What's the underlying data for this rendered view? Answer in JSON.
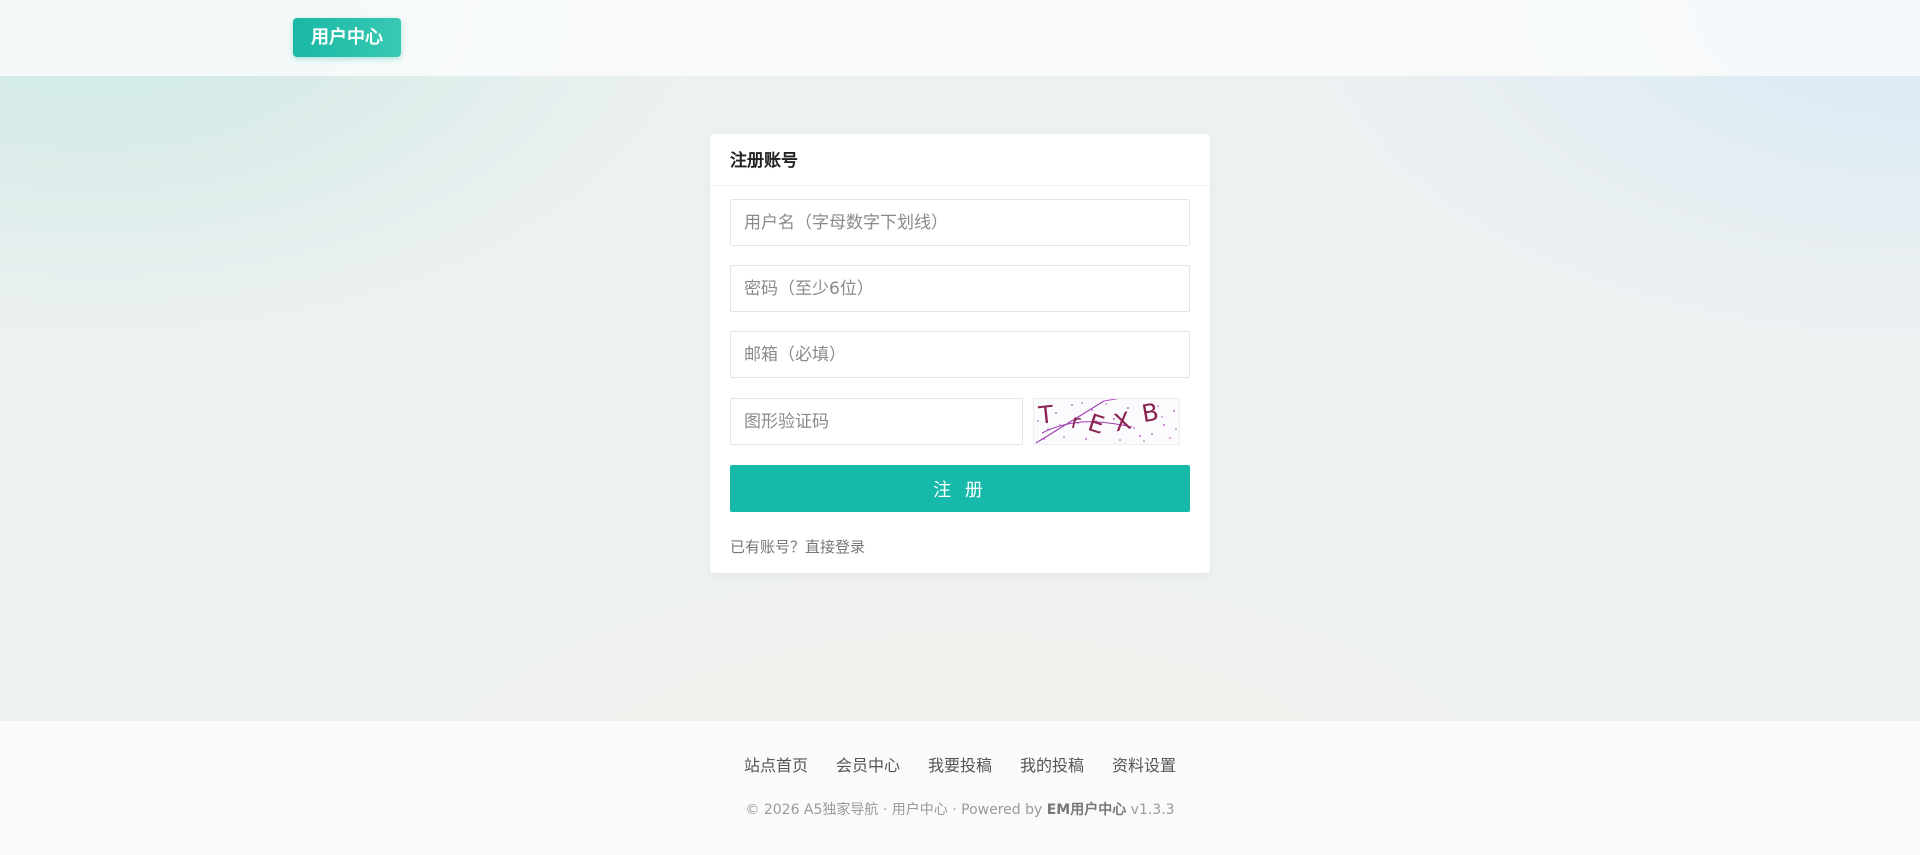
{
  "header": {
    "logo_label": "用户中心"
  },
  "register": {
    "title": "注册账号",
    "username_placeholder": "用户名（字母数字下划线）",
    "password_placeholder": "密码（至少6位）",
    "email_placeholder": "邮箱（必填）",
    "captcha_placeholder": "图形验证码",
    "captcha_text": "TrEXB",
    "submit_label": "注 册",
    "have_account_text": "已有账号？",
    "login_link": "直接登录"
  },
  "footer": {
    "nav": [
      "站点首页",
      "会员中心",
      "我要投稿",
      "我的投稿",
      "资料设置"
    ],
    "copyright_prefix": "© 2026 A5独家导航 · 用户中心 · Powered by ",
    "brand": "EM用户中心",
    "version": " v1.3.3"
  },
  "colors": {
    "accent": "#17baaa",
    "captcha_text": "#8b2252",
    "captcha_noise": "#b040c0"
  },
  "icons": {
    "captcha": "captcha-image"
  }
}
